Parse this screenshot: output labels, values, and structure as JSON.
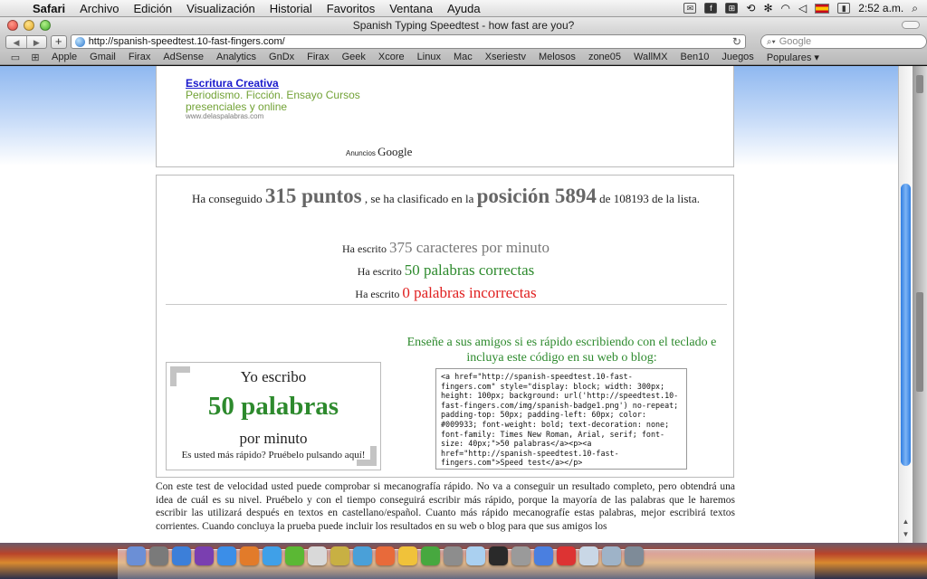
{
  "menubar": {
    "app": "Safari",
    "menus": [
      "Archivo",
      "Edición",
      "Visualización",
      "Historial",
      "Favoritos",
      "Ventana",
      "Ayuda"
    ],
    "clock": "2:52 a.m."
  },
  "window": {
    "title": "Spanish Typing Speedtest - how fast are you?"
  },
  "toolbar": {
    "url": "http://spanish-speedtest.10-fast-fingers.com/",
    "search_placeholder": "Google"
  },
  "bookmarks": [
    "Apple",
    "Gmail",
    "Firax",
    "AdSense",
    "Analytics",
    "GnDx",
    "Firax",
    "Geek",
    "Xcore",
    "Linux",
    "Mac",
    "Xseriestv",
    "Melosos",
    "zone05",
    "WallMX",
    "Ben10",
    "Juegos",
    "Populares ▾"
  ],
  "ad": {
    "link": "Escritura Creativa",
    "text": "Periodismo. Ficción. Ensayo Cursos presenciales y online",
    "url": "www.delaspalabras.com",
    "by_prefix": "Anuncios",
    "by_brand": "Google"
  },
  "result": {
    "score_prefix": "Ha conseguido",
    "score_value": "315 puntos",
    "score_mid": ", se ha clasificado en la",
    "rank_value": "posición 5894",
    "rank_suffix": "de 108193 de la lista.",
    "chars_prefix": "Ha escrito",
    "chars_value": "375 caracteres por minuto",
    "correct_prefix": "Ha escrito",
    "correct_value": "50 palabras correctas",
    "wrong_prefix": "Ha escrito",
    "wrong_value": "0 palabras incorrectas"
  },
  "badge": {
    "line1": "Yo escribo",
    "line2": "50 palabras",
    "line3": "por minuto",
    "line4": "Es usted más rápido? Pruébelo pulsando aquí!"
  },
  "share": {
    "text": "Enseñe a sus amigos si es rápido escribiendo con el teclado e incluya este código en su web o blog:",
    "code": "<a href=\"http://spanish-speedtest.10-fast-fingers.com\" style=\"display: block; width: 300px; height: 100px; background: url('http://speedtest.10-fast-fingers.com/img/spanish-badge1.png') no-repeat; padding-top: 50px; padding-left: 60px; color: #009933; font-weight: bold; text-decoration: none; font-family: Times New Roman, Arial, serif; font-size: 40px;\">50 palabras</a><p><a href=\"http://spanish-speedtest.10-fast-fingers.com\">Speed test</a></p>"
  },
  "paragraph": "Con este test de velocidad usted puede comprobar si mecanografía rápido. No va a conseguir un resultado completo, pero obtendrá una idea de cuál es su nivel. Pruébelo y con el tiempo conseguirá escribir más rápido, porque la mayoría de las palabras que le haremos escribir las utilizará después en textos en castellano/español. Cuanto más rápido mecanografíe estas palabras, mejor escribirá textos corrientes. Cuando concluya la prueba puede incluir los resultados en su web o blog para que sus amigos los",
  "dock": [
    "Finder",
    "Dashboard",
    "iChat",
    "Mail",
    "Safari",
    "Firefox",
    "iTunes",
    "Calendar",
    "Fireworks",
    "Photos",
    "Preview",
    "Adium",
    "Leaf",
    "Utility",
    "Cube",
    "Terminal",
    "Monitor",
    "Transmit",
    "Upload",
    "Apps",
    "Documents",
    "Downloads",
    "Trash"
  ],
  "colors": {
    "score_gray": "#666666",
    "green": "#2d8a2d",
    "red": "#e02020",
    "link_blue": "#1a1acc",
    "ad_green": "#72a236"
  }
}
